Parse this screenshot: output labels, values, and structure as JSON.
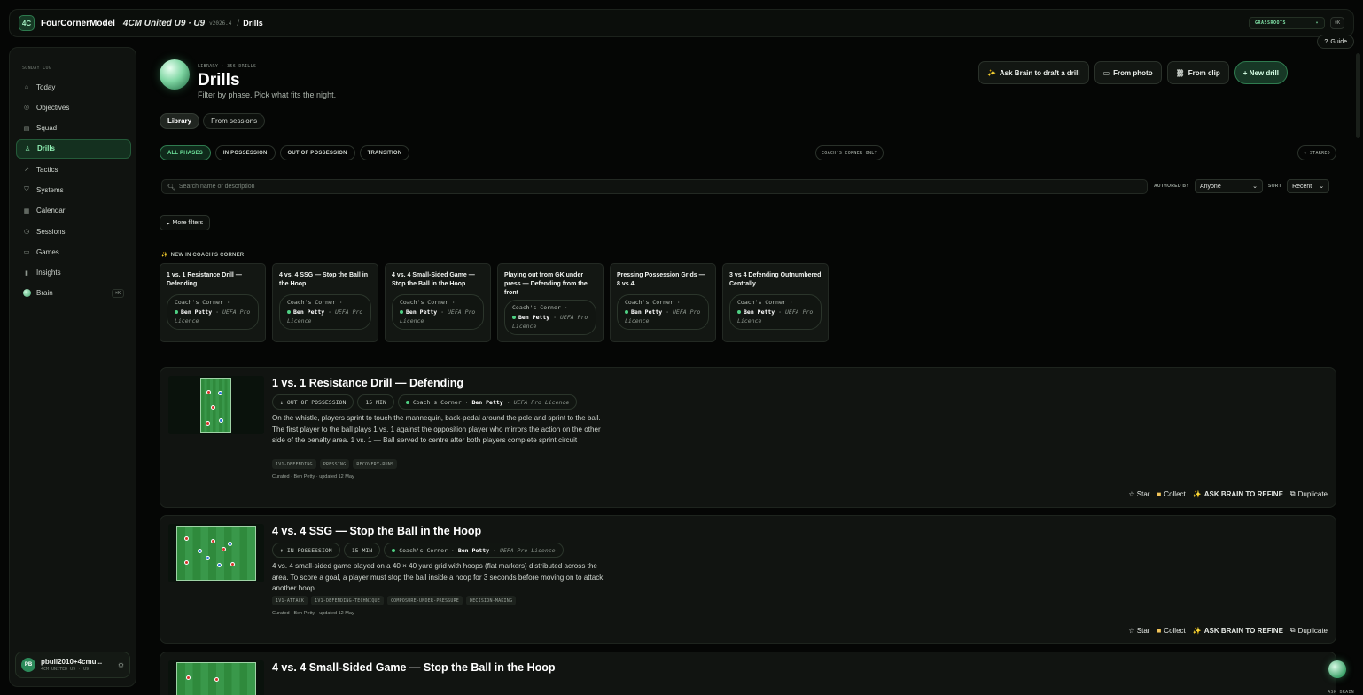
{
  "topbar": {
    "logo": "4C",
    "brand": "FourCornerModel",
    "team": "4CM United U9 · U9",
    "version": "v2026.4",
    "crumb_sep": "/",
    "crumb": "Drills",
    "level": "GRASSROOTS",
    "kbd": "⌘K",
    "guide": "Guide"
  },
  "sidebar": {
    "section_label": "SUNDAY LOG",
    "items": [
      {
        "label": "Today",
        "icon": "⌂"
      },
      {
        "label": "Objectives",
        "icon": "◎"
      },
      {
        "label": "Squad",
        "icon": "▤"
      },
      {
        "label": "Drills",
        "icon": "♙"
      },
      {
        "label": "Tactics",
        "icon": "↗"
      },
      {
        "label": "Systems",
        "icon": "⛉"
      },
      {
        "label": "Calendar",
        "icon": "▦"
      },
      {
        "label": "Sessions",
        "icon": "◷"
      },
      {
        "label": "Games",
        "icon": "▭"
      },
      {
        "label": "Insights",
        "icon": "▮"
      },
      {
        "label": "Brain",
        "icon": "",
        "kbd": "⌘K"
      }
    ],
    "user": {
      "initials": "PB",
      "name": "pbull2010+4cmu...",
      "team": "4CM UNITED U9 · U9",
      "gear": "⚙"
    }
  },
  "header": {
    "kicker": "LIBRARY · 356 DRILLS",
    "title": "Drills",
    "subtitle": "Filter by phase. Pick what fits the night.",
    "actions": {
      "ask_brain": "Ask Brain to draft a drill",
      "from_photo": "From photo",
      "from_clip": "From clip",
      "new_drill": "+ New drill"
    }
  },
  "source_tabs": [
    "Library",
    "From sessions"
  ],
  "phase_tabs": [
    "ALL PHASES",
    "IN POSSESSION",
    "OUT OF POSSESSION",
    "TRANSITION"
  ],
  "coach_corner_only": "COACH'S CORNER ONLY",
  "starred": "☆ STARRED",
  "search": {
    "placeholder": "Search name or description"
  },
  "authored_by": {
    "label": "AUTHORED BY",
    "value": "Anyone"
  },
  "sort": {
    "label": "SORT",
    "value": "Recent"
  },
  "more_filters": "More filters",
  "cc_section": {
    "title": "NEW IN COACH'S CORNER",
    "badge_prefix": "Coach's Corner ·",
    "badge_author": "Ben Petty",
    "badge_sep": "·",
    "badge_licence": "UEFA Pro Licence",
    "cards": [
      "1 vs. 1 Resistance Drill — Defending",
      "4 vs. 4 SSG — Stop the Ball in the Hoop",
      "4 vs. 4 Small-Sided Game — Stop the Ball in the Hoop",
      "Playing out from GK under press — Defending from the front",
      "Pressing Possession Grids — 8 vs 4",
      "3 vs 4 Defending Outnumbered Centrally"
    ]
  },
  "drills": [
    {
      "title": "1 vs. 1 Resistance Drill — Defending",
      "phase": "↓ OUT OF POSSESSION",
      "duration": "15 MIN",
      "badge_prefix": "Coach's Corner ·",
      "author": "Ben Petty",
      "licence": "UEFA Pro Licence",
      "description": "On the whistle, players sprint to touch the mannequin, back-pedal around the pole and sprint to the ball. The first player to the ball plays 1 vs. 1 against the opposition player who mirrors the action on the other side of the penalty area. 1 vs. 1 — Ball served to centre after both players complete sprint circuit",
      "tags": [
        "1V1-DEFENDING",
        "PRESSING",
        "RECOVERY-RUNS"
      ],
      "curated": "Curated · Ben Petty · updated 12 May"
    },
    {
      "title": "4 vs. 4 SSG — Stop the Ball in the Hoop",
      "phase": "↑ IN POSSESSION",
      "duration": "15 MIN",
      "badge_prefix": "Coach's Corner ·",
      "author": "Ben Petty",
      "licence": "UEFA Pro Licence",
      "description": "4 vs. 4 small-sided game played on a 40 × 40 yard grid with hoops (flat markers) distributed across the area. To score a goal, a player must stop the ball inside a hoop for 3 seconds before moving on to attack another hoop.",
      "tags": [
        "1V1-ATTACK",
        "1V1-DEFENDING-TECHNIQUE",
        "COMPOSURE-UNDER-PRESSURE",
        "DECISION-MAKING"
      ],
      "curated": "Curated · Ben Petty · updated 12 May"
    },
    {
      "title": "4 vs. 4 Small-Sided Game — Stop the Ball in the Hoop"
    }
  ],
  "card_actions": {
    "star": "☆ Star",
    "collect": "Collect",
    "refine": "ASK BRAIN TO REFINE",
    "duplicate": "Duplicate"
  },
  "fab_label": "ASK BRAIN"
}
